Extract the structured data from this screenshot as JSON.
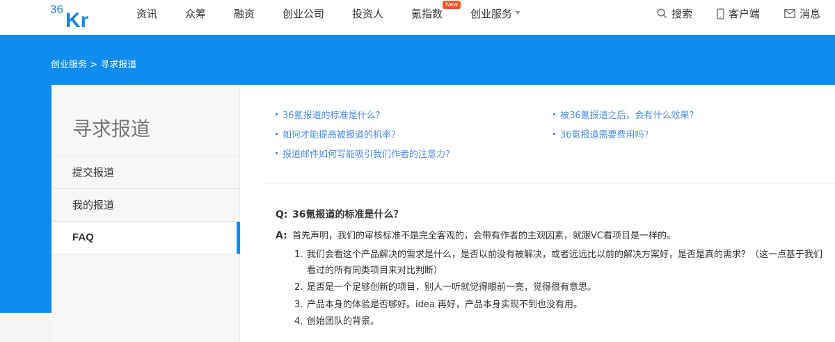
{
  "header": {
    "logo_text": "36Kr",
    "nav": [
      {
        "label": "资讯"
      },
      {
        "label": "众筹"
      },
      {
        "label": "融资"
      },
      {
        "label": "创业公司"
      },
      {
        "label": "投资人"
      },
      {
        "label": "氪指数",
        "badge": "New"
      },
      {
        "label": "创业服务",
        "has_dropdown": true
      }
    ],
    "right": {
      "search": "搜索",
      "client": "客户端",
      "messages": "消息"
    }
  },
  "breadcrumb": {
    "parent": "创业服务",
    "separator": ">",
    "current": "寻求报道"
  },
  "sidebar": {
    "title": "寻求报道",
    "items": [
      {
        "label": "提交报道",
        "active": false
      },
      {
        "label": "我的报道",
        "active": false
      },
      {
        "label": "FAQ",
        "active": true
      }
    ]
  },
  "faq_links": [
    "36氪报道的标准是什么？",
    "被36氪报道之后，会有什么效果？",
    "如何才能提高被报道的机率？",
    "36氪报道需要费用吗？",
    "报道邮件如何写能吸引我们作者的注意力？"
  ],
  "qa": {
    "q_label": "Q:",
    "question": "36氪报道的标准是什么？",
    "a_label": "A:",
    "answer": "首先声明，我们的审核标准不是完全客观的，会带有作者的主观因素，就跟VC看项目是一样的。",
    "points": [
      {
        "num": "1.",
        "line1": "我们会看这个产品解决的需求是什么，是否以前没有被解决，或者远远比以前的解决方案好，是否是真的需求？（这一点基于我们",
        "line2": "看过的所有同类项目来对比判断）"
      },
      {
        "num": "2.",
        "line1": "是否是一个足够创新的项目，别人一听就觉得眼前一亮，觉得很有意思。"
      },
      {
        "num": "3.",
        "line1": "产品本身的体验是否够好。idea 再好，产品本身实现不到也没有用。"
      },
      {
        "num": "4.",
        "line1": "创始团队的背景。"
      }
    ]
  },
  "colors": {
    "brand_blue": "#0f8cee",
    "link_blue": "#4a8ee6",
    "badge_red": "#f5542b"
  }
}
